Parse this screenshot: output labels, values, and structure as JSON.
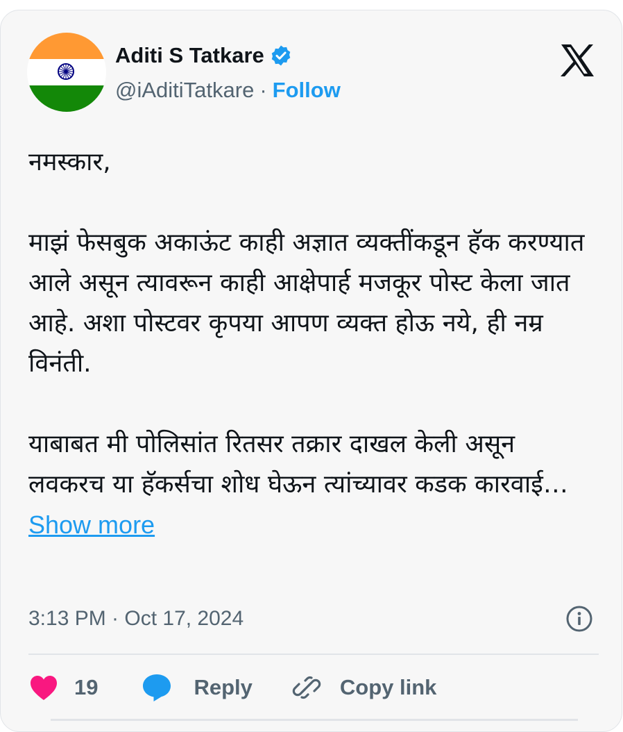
{
  "author": {
    "name": "Aditi S Tatkare",
    "handle": "@iAditiTatkare",
    "separator": "·",
    "follow_label": "Follow",
    "avatar_icon": "india-flag-avatar",
    "verified_icon": "verified-badge-icon"
  },
  "platform_icon": "x-logo-icon",
  "tweet": {
    "paragraphs": [
      "नमस्कार,",
      "माझं फेसबुक अकाऊंट काही अज्ञात व्यक्तींकडून हॅक करण्यात आले असून त्यावरून काही आक्षेपार्ह मजकूर पोस्ट केला जात आहे. अशा पोस्टवर कृपया आपण व्यक्त होऊ नये, ही नम्र विनंती.",
      "याबाबत मी पोलिसांत रितसर तक्रार दाखल केली असून लवकरच या हॅकर्सचा शोध घेऊन त्यांच्यावर कडक कारवाई…"
    ],
    "show_more_label": "Show more"
  },
  "meta": {
    "timestamp": "3:13 PM · Oct 17, 2024",
    "info_icon": "info-icon"
  },
  "actions": {
    "like_count": "19",
    "reply_label": "Reply",
    "copy_link_label": "Copy link"
  },
  "colors": {
    "accent": "#1d9bf0",
    "like": "#f91880",
    "muted": "#536471",
    "text": "#0f1419"
  }
}
